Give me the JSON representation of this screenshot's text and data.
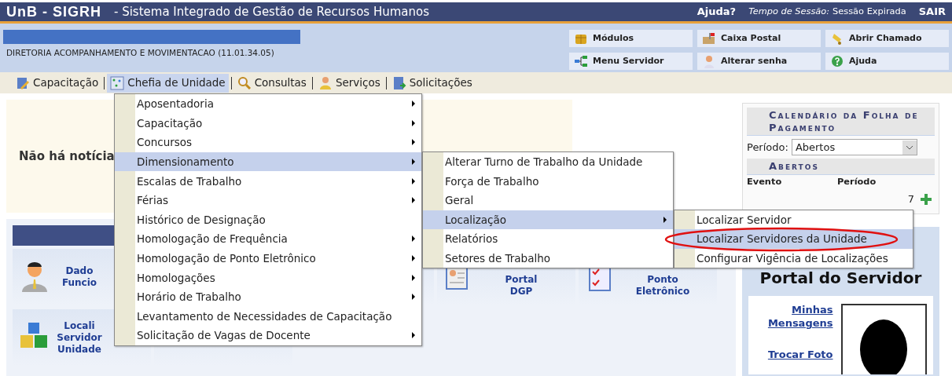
{
  "header": {
    "logo": "UnB - SIGRH",
    "title": "- Sistema Integrado de Gestão de Recursos Humanos",
    "help": "Ajuda?",
    "session_label": "Tempo de Sessão:",
    "session_value": "Sessão Expirada",
    "logout": "SAIR"
  },
  "user_info": {
    "unit": "DIRETORIA ACOMPANHAMENTO E MOVIMENTACAO (11.01.34.05)"
  },
  "shortcuts": [
    {
      "label": "Módulos"
    },
    {
      "label": "Caixa Postal"
    },
    {
      "label": "Abrir Chamado"
    },
    {
      "label": "Menu Servidor"
    },
    {
      "label": "Alterar senha"
    },
    {
      "label": "Ajuda"
    }
  ],
  "menu_bar": [
    {
      "label": "Capacitação",
      "selected": false
    },
    {
      "label": "Chefia de Unidade",
      "selected": true,
      "children": [
        {
          "label": "Aposentadoria",
          "submenu": true,
          "selected": false
        },
        {
          "label": "Capacitação",
          "submenu": true,
          "selected": false
        },
        {
          "label": "Concursos",
          "submenu": true,
          "selected": false
        },
        {
          "label": "Dimensionamento",
          "submenu": true,
          "selected": true,
          "children": [
            {
              "label": "Alterar Turno de Trabalho da Unidade",
              "submenu": false,
              "selected": false
            },
            {
              "label": "Força de Trabalho",
              "submenu": false,
              "selected": false
            },
            {
              "label": "Geral",
              "submenu": false,
              "selected": false
            },
            {
              "label": "Localização",
              "submenu": true,
              "selected": true,
              "children": [
                {
                  "label": "Localizar Servidor",
                  "submenu": false,
                  "selected": false
                },
                {
                  "label": "Localizar Servidores da Unidade",
                  "submenu": false,
                  "selected": true
                },
                {
                  "label": "Configurar Vigência de Localizações",
                  "submenu": false,
                  "selected": false
                }
              ]
            },
            {
              "label": "Relatórios",
              "submenu": false,
              "selected": false
            },
            {
              "label": "Setores de Trabalho",
              "submenu": false,
              "selected": false
            }
          ]
        },
        {
          "label": "Escalas de Trabalho",
          "submenu": true,
          "selected": false
        },
        {
          "label": "Férias",
          "submenu": true,
          "selected": false
        },
        {
          "label": "Histórico de Designação",
          "submenu": false,
          "selected": false
        },
        {
          "label": "Homologação de Frequência",
          "submenu": true,
          "selected": false
        },
        {
          "label": "Homologação de Ponto Eletrônico",
          "submenu": true,
          "selected": false
        },
        {
          "label": "Homologações",
          "submenu": true,
          "selected": false
        },
        {
          "label": "Horário de Trabalho",
          "submenu": true,
          "selected": false
        },
        {
          "label": "Levantamento de Necessidades de Capacitação",
          "submenu": false,
          "selected": false
        },
        {
          "label": "Solicitação de Vagas de Docente",
          "submenu": true,
          "selected": false
        }
      ]
    },
    {
      "label": "Consultas",
      "selected": false
    },
    {
      "label": "Serviços",
      "selected": false
    },
    {
      "label": "Solicitações",
      "selected": false
    }
  ],
  "news": {
    "text": "Não há notícia"
  },
  "tiles": [
    {
      "lines": [
        "Dado",
        "Funcio"
      ]
    },
    {
      "lines": [
        "Portal",
        "DGP"
      ]
    },
    {
      "lines": [
        "Ponto",
        "Eletrônico"
      ]
    },
    {
      "lines": [
        "Locali",
        "Servidor",
        "Unidade"
      ]
    }
  ],
  "calendar": {
    "title": "Calendário da Folha de Pagamento",
    "period_label": "Período:",
    "period_value": "Abertos",
    "section": "Abertos",
    "columns": [
      "Evento",
      "Período"
    ],
    "row_fragment": "7"
  },
  "portal": {
    "title": "Portal do Servidor",
    "links": [
      "Minhas Mensagens",
      "Trocar Foto"
    ]
  }
}
